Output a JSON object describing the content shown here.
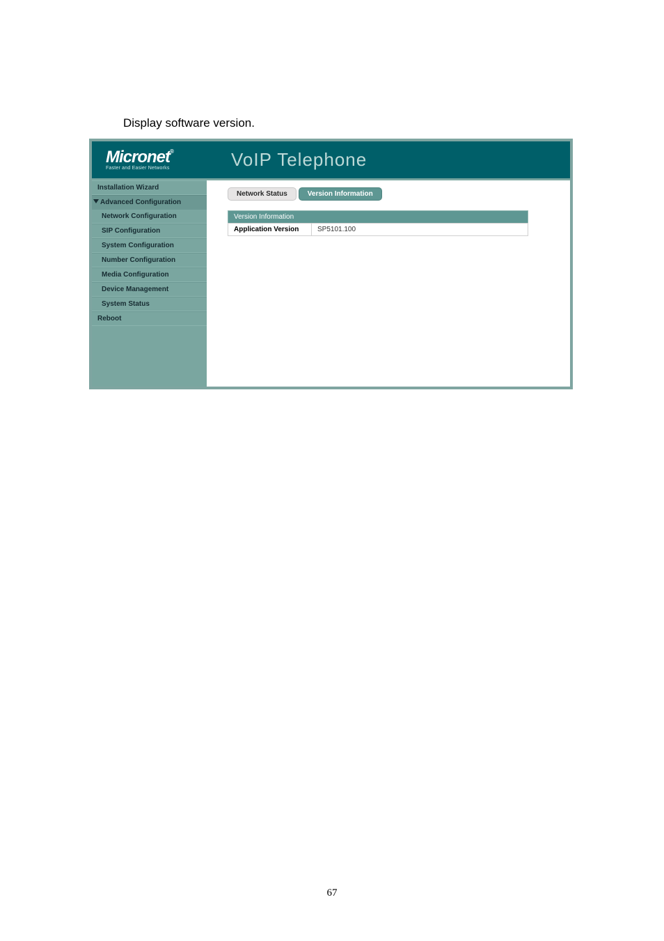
{
  "caption": "Display software version.",
  "logo": {
    "main": "Micronet",
    "tag": "Faster and Easier Networks"
  },
  "header": {
    "title": "VoIP Telephone"
  },
  "sidebar": {
    "installation_wizard": "Installation Wizard",
    "advanced_section": "Advanced Configuration",
    "network_config": "Network Configuration",
    "sip_config": "SIP Configuration",
    "system_config": "System Configuration",
    "number_config": "Number Configuration",
    "media_config": "Media Configuration",
    "device_mgmt": "Device Management",
    "system_status": "System Status",
    "reboot": "Reboot"
  },
  "tabs": {
    "network_status": "Network Status",
    "version_info": "Version Information"
  },
  "panel": {
    "header": "Version Information",
    "app_version_label": "Application Version",
    "app_version_value": "SP5101.100"
  },
  "page_number": "67"
}
